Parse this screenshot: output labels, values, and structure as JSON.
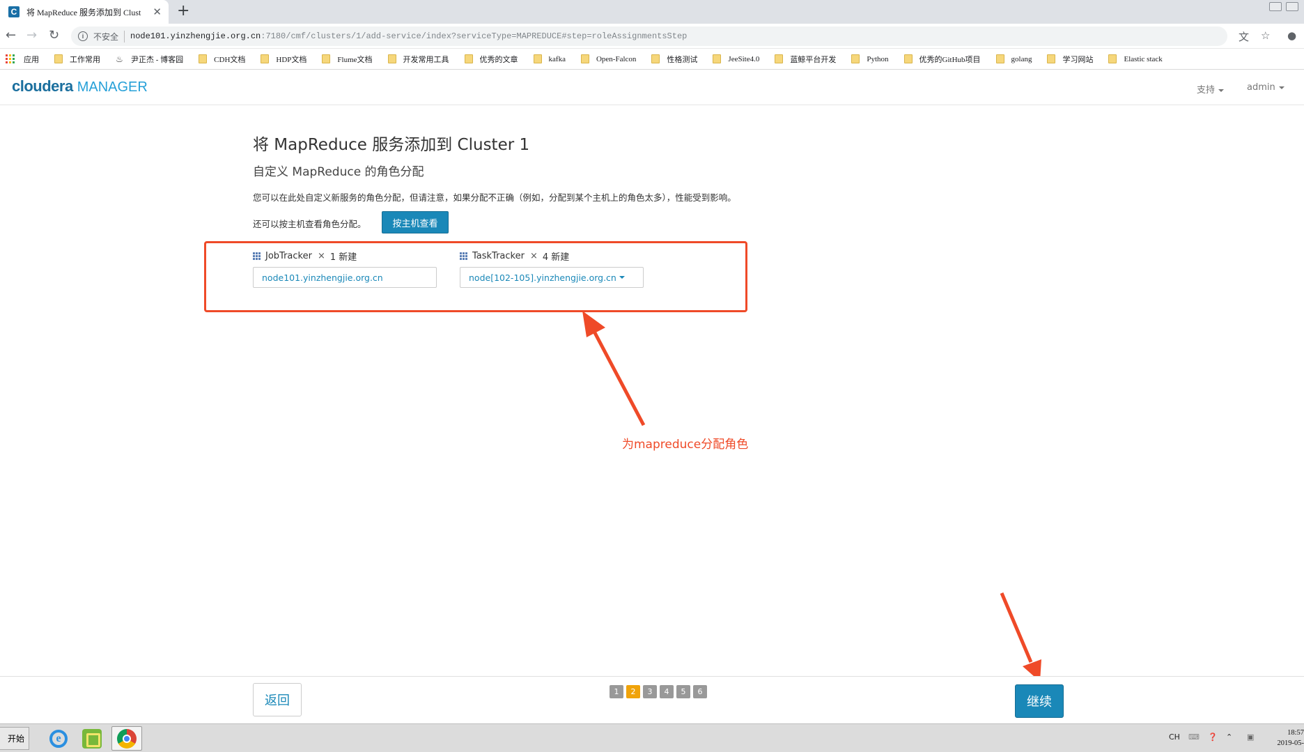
{
  "browser": {
    "tab_title": "将 MapReduce 服务添加到 Clust",
    "tab_favicon": "C",
    "tab_close": "✕",
    "new_tab": "+",
    "insecure_label": "不安全",
    "url_host": "node101.yinzhengjie.org.cn",
    "url_rest": ":7180/cmf/clusters/1/add-service/index?serviceType=MAPREDUCE#step=roleAssignmentsStep"
  },
  "bookmarks": {
    "apps_label": "应用",
    "items": [
      {
        "label": "工作常用",
        "icon": "folder-icon"
      },
      {
        "label": "尹正杰 - 博客园",
        "icon": "blog-icon"
      },
      {
        "label": "CDH文档",
        "icon": "folder-icon"
      },
      {
        "label": "HDP文档",
        "icon": "folder-icon"
      },
      {
        "label": "Flume文档",
        "icon": "folder-icon"
      },
      {
        "label": "开发常用工具",
        "icon": "folder-icon"
      },
      {
        "label": "优秀的文章",
        "icon": "folder-icon"
      },
      {
        "label": "kafka",
        "icon": "folder-icon"
      },
      {
        "label": "Open-Falcon",
        "icon": "folder-icon"
      },
      {
        "label": "性格测试",
        "icon": "folder-icon"
      },
      {
        "label": "JeeSite4.0",
        "icon": "folder-icon"
      },
      {
        "label": "蓝鲸平台开发",
        "icon": "folder-icon"
      },
      {
        "label": "Python",
        "icon": "folder-icon"
      },
      {
        "label": "优秀的GitHub项目",
        "icon": "folder-icon"
      },
      {
        "label": "golang",
        "icon": "folder-icon"
      },
      {
        "label": "学习网站",
        "icon": "folder-icon"
      },
      {
        "label": "Elastic stack",
        "icon": "folder-icon"
      }
    ]
  },
  "header": {
    "logo_main": "cloudera",
    "logo_sub": "MANAGER",
    "support_label": "支持",
    "user_label": "admin"
  },
  "main": {
    "title": "将 MapReduce 服务添加到 Cluster 1",
    "subtitle": "自定义 MapReduce 的角色分配",
    "description": "您可以在此处自定义新服务的角色分配，但请注意，如果分配不正确（例如，分配到某个主机上的角色太多），性能受到影响。",
    "view_by_host_text": "还可以按主机查看角色分配。",
    "view_by_host_button": "按主机查看",
    "roles": [
      {
        "name": "JobTracker",
        "times": "×",
        "count": "1 新建",
        "host": "node101.yinzhengjie.org.cn",
        "dropdown": false
      },
      {
        "name": "TaskTracker",
        "times": "×",
        "count": "4 新建",
        "host": "node[102-105].yinzhengjie.org.cn",
        "dropdown": true
      }
    ],
    "annotation": "为mapreduce分配角色"
  },
  "footer": {
    "back_label": "返回",
    "continue_label": "继续",
    "steps": [
      "1",
      "2",
      "3",
      "4",
      "5",
      "6"
    ],
    "active_step": "2"
  },
  "taskbar": {
    "start_label": "开始",
    "lang": "CH",
    "time": "18:57",
    "date": "2019-05-"
  },
  "colors": {
    "accent": "#1a88b8",
    "annotation": "#ef4a28",
    "active_step": "#f0a30a"
  }
}
